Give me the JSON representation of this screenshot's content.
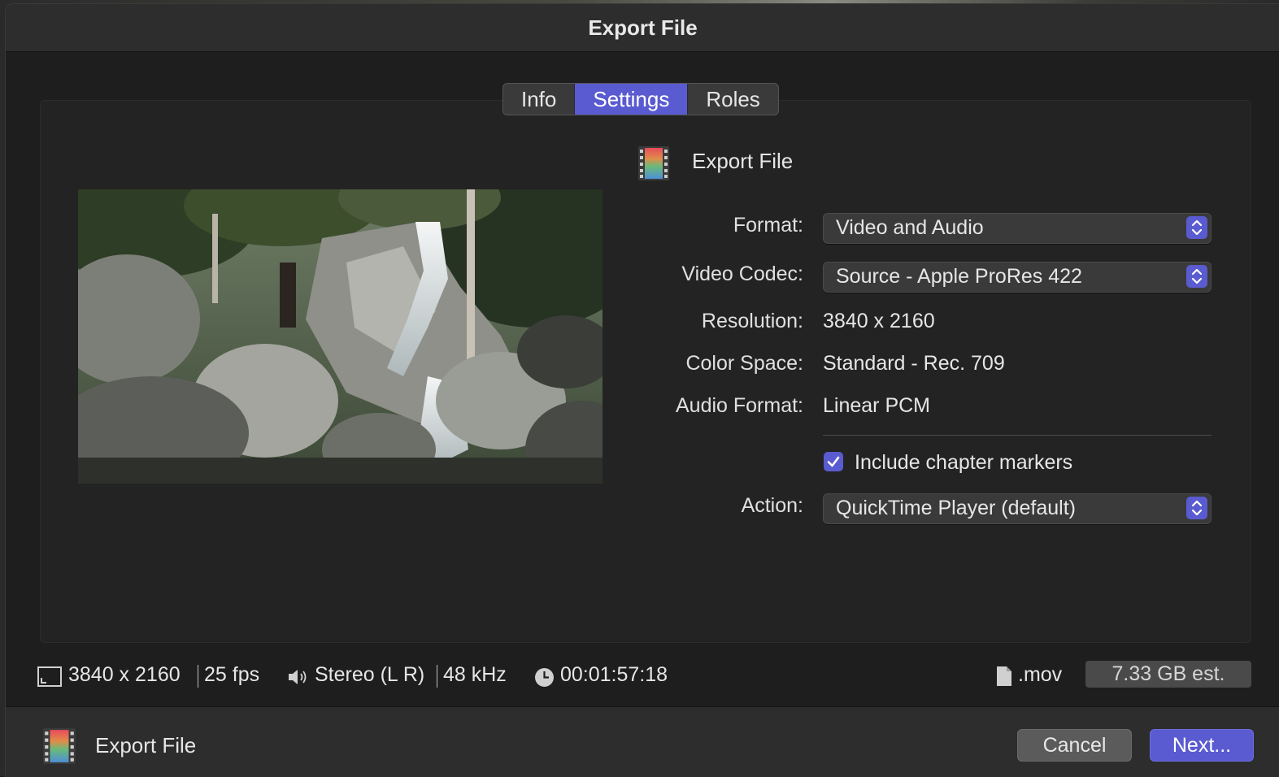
{
  "window": {
    "title": "Export File"
  },
  "tabs": [
    {
      "label": "Info",
      "active": false
    },
    {
      "label": "Settings",
      "active": true
    },
    {
      "label": "Roles",
      "active": false
    }
  ],
  "destination": {
    "label": "Export File",
    "icon": "film-strip-icon"
  },
  "settings": {
    "format": {
      "label": "Format:",
      "value": "Video and Audio"
    },
    "video_codec": {
      "label": "Video Codec:",
      "value": "Source - Apple ProRes 422"
    },
    "resolution": {
      "label": "Resolution:",
      "value": "3840 x 2160"
    },
    "color_space": {
      "label": "Color Space:",
      "value": "Standard - Rec. 709"
    },
    "audio_format": {
      "label": "Audio Format:",
      "value": "Linear PCM"
    },
    "chapter_markers": {
      "label": "Include chapter markers",
      "checked": true
    },
    "action": {
      "label": "Action:",
      "value": "QuickTime Player (default)"
    }
  },
  "status": {
    "resolution": "3840 x 2160",
    "fps": "25 fps",
    "audio_channels": "Stereo (L R)",
    "sample_rate": "48 kHz",
    "duration": "00:01:57:18",
    "file_extension": ".mov",
    "size_estimate": "7.33 GB est."
  },
  "footer": {
    "label": "Export File",
    "cancel_label": "Cancel",
    "next_label": "Next..."
  },
  "colors": {
    "accent": "#5a5bd0",
    "dialog_bg": "#1e1e1e",
    "panel_bg": "#232323"
  }
}
